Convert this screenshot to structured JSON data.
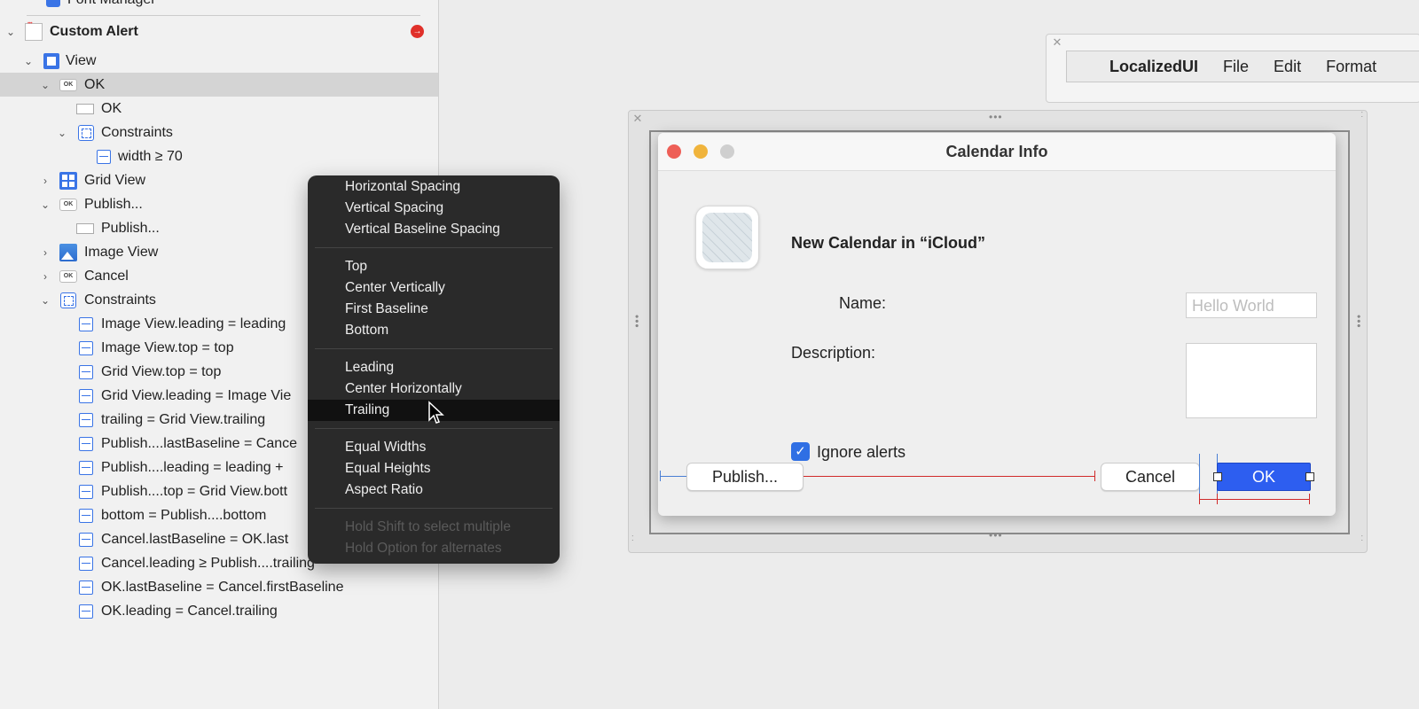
{
  "sidebar": {
    "rows": [
      {
        "label": "Font Manager",
        "icon": "object-icon"
      },
      {
        "label": "Custom Alert",
        "icon": "window-icon",
        "badge": "error-badge"
      },
      {
        "label": "View",
        "icon": "view-icon"
      },
      {
        "label": "OK",
        "icon": "button-icon"
      },
      {
        "label": "OK",
        "icon": "text-icon"
      },
      {
        "label": "Constraints",
        "icon": "constraints-icon"
      },
      {
        "label": "width ≥ 70",
        "icon": "width-constraint-icon"
      },
      {
        "label": "Grid View",
        "icon": "grid-view-icon"
      },
      {
        "label": "Publish...",
        "icon": "button-icon"
      },
      {
        "label": "Publish...",
        "icon": "text-icon"
      },
      {
        "label": "Image View",
        "icon": "image-view-icon"
      },
      {
        "label": "Cancel",
        "icon": "button-icon"
      },
      {
        "label": "Constraints",
        "icon": "constraints-icon"
      },
      {
        "label": "Image View.leading = leading",
        "icon": "constraint-icon"
      },
      {
        "label": "Image View.top = top",
        "icon": "constraint-icon"
      },
      {
        "label": "Grid View.top = top",
        "icon": "constraint-icon"
      },
      {
        "label": "Grid View.leading = Image Vie",
        "icon": "constraint-icon"
      },
      {
        "label": "trailing = Grid View.trailing",
        "icon": "constraint-icon"
      },
      {
        "label": "Publish....lastBaseline = Cance",
        "icon": "constraint-icon"
      },
      {
        "label": "Publish....leading = leading +",
        "icon": "constraint-icon"
      },
      {
        "label": "Publish....top = Grid View.bott",
        "icon": "constraint-icon"
      },
      {
        "label": "bottom = Publish....bottom",
        "icon": "constraint-icon"
      },
      {
        "label": "Cancel.lastBaseline = OK.last",
        "icon": "constraint-icon"
      },
      {
        "label": "Cancel.leading ≥ Publish....trailing",
        "icon": "constraint-icon"
      },
      {
        "label": "OK.lastBaseline = Cancel.firstBaseline",
        "icon": "constraint-icon"
      },
      {
        "label": "OK.leading = Cancel.trailing",
        "icon": "constraint-icon"
      }
    ]
  },
  "context_menu": {
    "group1": [
      "Horizontal Spacing",
      "Vertical Spacing",
      "Vertical Baseline Spacing"
    ],
    "group2": [
      "Top",
      "Center Vertically",
      "First Baseline",
      "Bottom"
    ],
    "group3": [
      "Leading",
      "Center Horizontally",
      "Trailing"
    ],
    "group4": [
      "Equal Widths",
      "Equal Heights",
      "Aspect Ratio"
    ],
    "hints": [
      "Hold Shift to select multiple",
      "Hold Option for alternates"
    ],
    "highlighted": "Trailing"
  },
  "app_menubar": {
    "items": [
      "LocalizedUI",
      "File",
      "Edit",
      "Format"
    ]
  },
  "dialog": {
    "title": "Calendar Info",
    "heading": "New Calendar in “iCloud”",
    "name_label": "Name:",
    "name_placeholder": "Hello World",
    "description_label": "Description:",
    "checkbox_label": "Ignore alerts",
    "checkbox_checked": true,
    "publish_button": "Publish...",
    "cancel_button": "Cancel",
    "ok_button": "OK"
  },
  "colors": {
    "accent": "#2d5ef0",
    "close": "#ee5f57",
    "minimize": "#f0b43c",
    "zoom": "#cfcfcf",
    "constraint_line": "#d02a2a"
  }
}
